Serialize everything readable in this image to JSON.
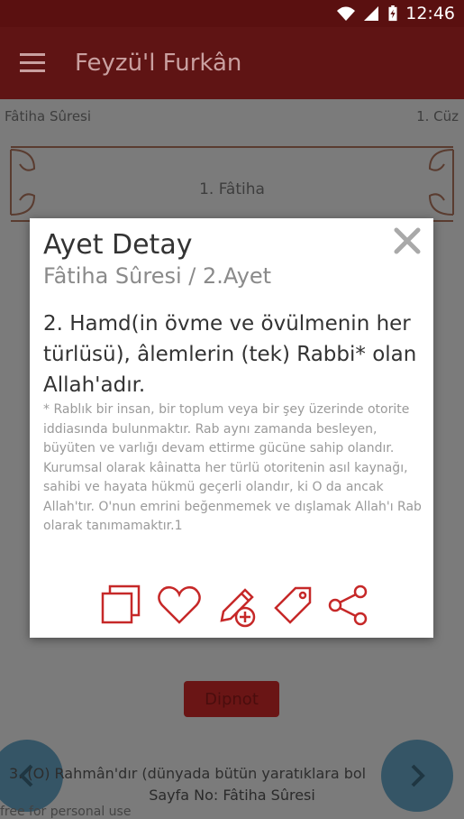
{
  "status": {
    "time": "12:46"
  },
  "appbar": {
    "title": "Feyzü'l Furkân",
    "menu_icon": "hamburger-icon"
  },
  "page": {
    "sura_label": "Fâtiha Sûresi",
    "cuz_label": "1. Cüz",
    "frame_title": "1. Fâtiha",
    "dipnot_button": "Dipnot",
    "footer_page": "Sayfa No: Fâtiha Sûresi",
    "footer_free": "free for personal use",
    "peek_bottom": "3. (O) Rahmân'dır (dünyada bütün yaratıklara bol"
  },
  "dialog": {
    "title": "Ayet Detay",
    "subtitle": "Fâtiha Sûresi / 2.Ayet",
    "verse": "2. Hamd(in övme ve övülmenin her türlüsü), âlemlerin (tek) Rabbi* olan Allah'adır.",
    "note": "* Rablık bir insan, bir toplum veya bir şey üzerinde otorite iddiasında bulunmaktır. Rab aynı zamanda besleyen, büyüten ve varlığı devam ettirme gücüne sahip olandır. Kurumsal olarak kâinatta her türlü otoritenin asıl kaynağı, sahibi ve hayata hükmü geçerli olandır, ki O da ancak Allah'tır. O'nun emrini beğenmemek ve dışlamak Allah'ı Rab olarak tanımamaktır.1",
    "actions": [
      "copy-icon",
      "heart-icon",
      "add-note-icon",
      "tag-icon",
      "share-icon"
    ]
  },
  "colors": {
    "accent": "#c62828",
    "appbar": "#b71c1c",
    "fab": "#4a7a94"
  }
}
